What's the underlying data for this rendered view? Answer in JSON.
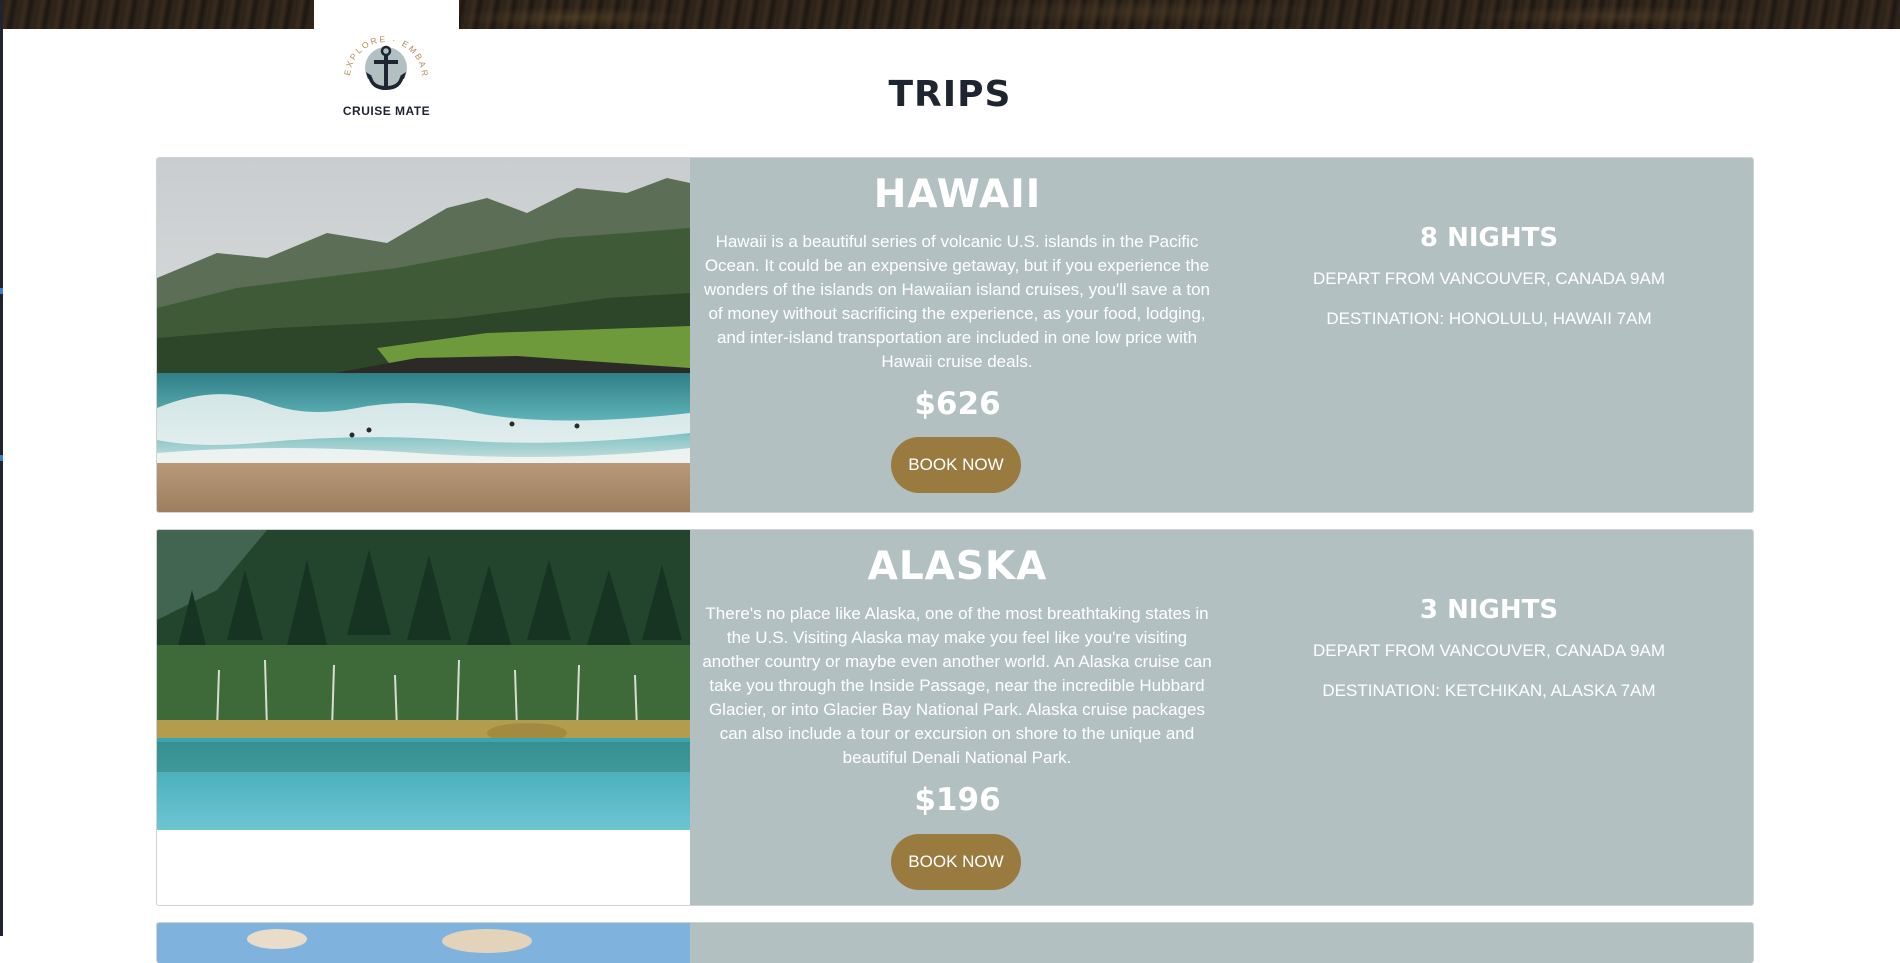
{
  "brand": {
    "name": "CRUISE MATE",
    "tagline": "EXPLORE · EMBARK · ENJOY!"
  },
  "page": {
    "title": "TRIPS"
  },
  "colors": {
    "card_info_bg": "#b3c0c2",
    "button_bg": "#9a7b3f",
    "title_text": "#1f2530"
  },
  "trips": [
    {
      "name": "HAWAII",
      "description": "Hawaii is a beautiful series of volcanic U.S. islands in the Pacific Ocean. It could be an expensive getaway, but if you experience the wonders of the islands on Hawaiian island cruises, you'll save a ton of money without sacrificing the experience, as your food, lodging, and inter-island transportation are included in one low price with Hawaii cruise deals.",
      "price": "$626",
      "button": "BOOK NOW",
      "nights": "8 NIGHTS",
      "depart": "DEPART FROM VANCOUVER, CANADA 9AM",
      "destination": "DESTINATION: HONOLULU, HAWAII 7AM",
      "image": "hawaii-beach-mountains-photo"
    },
    {
      "name": "ALASKA",
      "description": "There's no place like Alaska, one of the most breathtaking states in the U.S. Visiting Alaska may make you feel like you're visiting another country or maybe even another world. An Alaska cruise can take you through the Inside Passage, near the incredible Hubbard Glacier, or into Glacier Bay National Park. Alaska cruise packages can also include a tour or excursion on shore to the unique and beautiful Denali National Park.",
      "price": "$196",
      "button": "BOOK NOW",
      "nights": "3 NIGHTS",
      "depart": "DEPART FROM VANCOUVER, CANADA 9AM",
      "destination": "DESTINATION: KETCHIKAN, ALASKA 7AM",
      "image": "alaska-forest-lake-photo"
    }
  ]
}
